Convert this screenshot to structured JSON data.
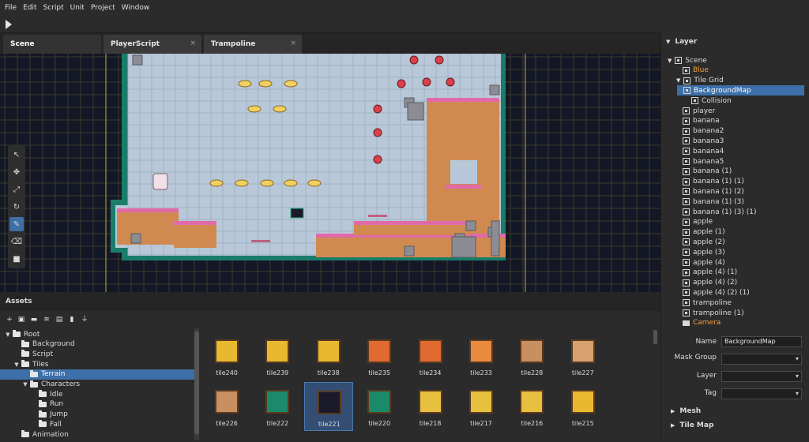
{
  "menu": [
    "File",
    "Edit",
    "Script",
    "Unit",
    "Project",
    "Window"
  ],
  "tabs": [
    {
      "label": "Scene",
      "closable": false
    },
    {
      "label": "PlayerScript",
      "closable": true
    },
    {
      "label": "Trampoline",
      "closable": true
    }
  ],
  "close_glyph": "×",
  "tools": [
    "select-tool",
    "move-tool",
    "scale-tool",
    "rotate-tool",
    "pencil-tool",
    "eraser-tool",
    "rectangle-tool"
  ],
  "assets": {
    "title": "Assets",
    "tree": [
      {
        "label": "Root",
        "depth": 0,
        "expanded": true
      },
      {
        "label": "Background",
        "depth": 1
      },
      {
        "label": "Script",
        "depth": 1
      },
      {
        "label": "Tiles",
        "depth": 1,
        "expanded": true
      },
      {
        "label": "Terrain",
        "depth": 2,
        "selected": true
      },
      {
        "label": "Characters",
        "depth": 2,
        "expanded": true
      },
      {
        "label": "Idle",
        "depth": 3
      },
      {
        "label": "Run",
        "depth": 3
      },
      {
        "label": "Jump",
        "depth": 3
      },
      {
        "label": "Fall",
        "depth": 3
      },
      {
        "label": "Animation",
        "depth": 1
      }
    ],
    "tiles_row1": [
      "tile240",
      "tile239",
      "tile238",
      "tile235",
      "tile234",
      "tile233",
      "tile228",
      "tile227"
    ],
    "tiles_row2": [
      "tile226",
      "tile222",
      "tile221",
      "tile220",
      "tile218",
      "tile217",
      "tile216",
      "tile215"
    ],
    "selected_tile": "tile221"
  },
  "layer": {
    "title": "Layer",
    "nodes": [
      {
        "label": "Scene",
        "depth": 0,
        "kind": "scene",
        "expanded": true
      },
      {
        "label": "Blue",
        "depth": 1,
        "kind": "image"
      },
      {
        "label": "Tile Grid",
        "depth": 1,
        "kind": "node",
        "expanded": true
      },
      {
        "label": "BackgroundMap",
        "depth": 2,
        "kind": "node",
        "selected": true
      },
      {
        "label": "Collision",
        "depth": 2,
        "kind": "node"
      },
      {
        "label": "player",
        "depth": 1,
        "kind": "node"
      },
      {
        "label": "banana",
        "depth": 1,
        "kind": "node"
      },
      {
        "label": "banana2",
        "depth": 1,
        "kind": "node"
      },
      {
        "label": "banana3",
        "depth": 1,
        "kind": "node"
      },
      {
        "label": "banana4",
        "depth": 1,
        "kind": "node"
      },
      {
        "label": "banana5",
        "depth": 1,
        "kind": "node"
      },
      {
        "label": "banana (1)",
        "depth": 1,
        "kind": "node"
      },
      {
        "label": "banana (1) (1)",
        "depth": 1,
        "kind": "node"
      },
      {
        "label": "banana (1) (2)",
        "depth": 1,
        "kind": "node"
      },
      {
        "label": "banana (1) (3)",
        "depth": 1,
        "kind": "node"
      },
      {
        "label": "banana (1) (3) (1)",
        "depth": 1,
        "kind": "node"
      },
      {
        "label": "apple",
        "depth": 1,
        "kind": "node"
      },
      {
        "label": "apple (1)",
        "depth": 1,
        "kind": "node"
      },
      {
        "label": "apple (2)",
        "depth": 1,
        "kind": "node"
      },
      {
        "label": "apple (3)",
        "depth": 1,
        "kind": "node"
      },
      {
        "label": "apple (4)",
        "depth": 1,
        "kind": "node"
      },
      {
        "label": "apple (4) (1)",
        "depth": 1,
        "kind": "node"
      },
      {
        "label": "apple (4) (2)",
        "depth": 1,
        "kind": "node"
      },
      {
        "label": "apple (4) (2) (1)",
        "depth": 1,
        "kind": "node"
      },
      {
        "label": "trampoline",
        "depth": 1,
        "kind": "node"
      },
      {
        "label": "trampoline (1)",
        "depth": 1,
        "kind": "node"
      },
      {
        "label": "Camera",
        "depth": 1,
        "kind": "camera"
      }
    ]
  },
  "properties": {
    "name_label": "Name",
    "name_value": "BackgroundMap",
    "mask_label": "Mask Group",
    "layer_label": "Layer",
    "tag_label": "Tag",
    "sections": [
      "Mesh",
      "Tile Map"
    ]
  },
  "colors": {
    "accent": "#3d6fa8",
    "orange": "#f0a040",
    "pink": "#e06aa8",
    "dirt": "#d08a50",
    "teal": "#2bb08a"
  }
}
